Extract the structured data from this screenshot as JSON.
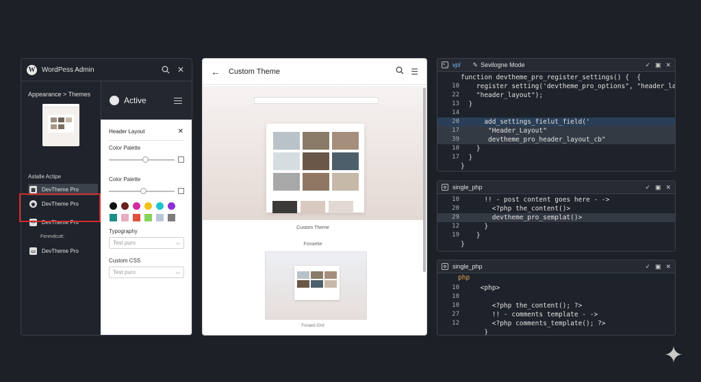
{
  "wp_admin": {
    "title": "WordPess Admin",
    "breadcrumb": "Appearance > Themes",
    "installed_label": "Astalle Actipe",
    "themes": [
      {
        "label": "DevTheme Pro",
        "selected": true
      },
      {
        "label": "DevTheme Pro",
        "selected": false
      },
      {
        "label": "DevTheme Pro",
        "selected": false
      },
      {
        "label": "DevTheme Pro",
        "selected": false
      }
    ],
    "theme_sublabel": "Fenmdcutt:",
    "customizer": {
      "active_label": "Active",
      "header_layout": "Header Layout",
      "color_palette_1": "Color Palette",
      "color_palette_2": "Color Palette",
      "slider_1_value": 0.55,
      "slider_2_value": 0.52,
      "swatch_colors_row1": [
        "#111111",
        "#6b1f1f",
        "#d42aa0",
        "#f2c21b",
        "#1fc4cc",
        "#8b2fd6"
      ],
      "swatch_colors_row2": [
        "#1d8e86",
        "#e6aec0",
        "#e2503a",
        "#86d25a",
        "#b9c6d6",
        "#7b7b7b"
      ],
      "typography_label": "Typography",
      "typography_value": "Test puro",
      "custom_css_label": "Custom CSS",
      "custom_css_value": "Test puro"
    }
  },
  "preview": {
    "title": "Custom Theme",
    "caption_1": "Custom Theme",
    "caption_2": "Fonaetie",
    "caption_3": "Fonaed iOrd"
  },
  "code_panels": [
    {
      "tab_1": "vpl",
      "tab_2": "Sevilogne Mode",
      "lines": [
        {
          "n": "",
          "text": "function devtheme_pro_register_settings() {  {"
        },
        {
          "n": "10",
          "text": "    register setting('devtheme_pro_options\", \"header_layouts');"
        },
        {
          "n": "22",
          "text": "    \"header_layout\");"
        },
        {
          "n": "13",
          "text": "  }"
        },
        {
          "n": "14",
          "text": ""
        },
        {
          "n": "20",
          "text": "      add_settings_fielut_field('"
        },
        {
          "n": "17",
          "text": "       \"Header_Layout\""
        },
        {
          "n": "39",
          "text": "       devtheme_pro_header_layout_cb\""
        },
        {
          "n": "10",
          "text": "    }"
        },
        {
          "n": "17",
          "text": "  }"
        },
        {
          "n": "",
          "text": "}"
        }
      ],
      "highlight_rows": [
        5,
        6,
        7
      ],
      "blue_row": 5
    },
    {
      "title": "single_php",
      "lines": [
        {
          "n": "10",
          "text": "      !! - post content goes here - ->"
        },
        {
          "n": "20",
          "text": "        <?php the_content()>"
        },
        {
          "n": "29",
          "text": "        devtheme_pro_semplat()>"
        },
        {
          "n": "12",
          "text": "      }"
        },
        {
          "n": "19",
          "text": "    }"
        },
        {
          "n": "",
          "text": "}"
        }
      ],
      "highlight_rows": [
        2
      ]
    },
    {
      "title": "single_php",
      "php_label": "php",
      "lines": [
        {
          "n": "10",
          "text": "     <php>"
        },
        {
          "n": "10",
          "text": ""
        },
        {
          "n": "10",
          "text": "        <?php the_content(); ?>"
        },
        {
          "n": "27",
          "text": "        !! - comments template - ->"
        },
        {
          "n": "12",
          "text": "        <?php comments_template(); ?>"
        },
        {
          "n": "",
          "text": "      }"
        }
      ]
    }
  ]
}
